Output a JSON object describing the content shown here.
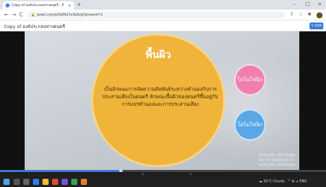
{
  "browser": {
    "tab_title": "Copy of องค์ประกอบทางดนตรี - P",
    "tab_close": "×",
    "new_tab": "+",
    "url": "prezi.com/p/5d0fa7e3e0zg?present=1",
    "nav_back": "←",
    "nav_forward": "→",
    "nav_reload": "C",
    "lock": "🔒"
  },
  "doc": {
    "title": "Copy of องค์ประกอบทางดนตรี",
    "edit_label": "✎ Edit"
  },
  "slide": {
    "main_title": "พื้นผิว",
    "main_body": "เป็นลักษณะการจัดความสัมพันธ์ระหว่างทำนองกับการประสานเสียงในดนตรี ลักษณะพื้นผิวของดนตรีขึ้นอยู่กับการแปรทำนองและการประสานเสียง",
    "circle_pink": "โมโนโฟนิก",
    "circle_blue": "โฮโมโฟนิก",
    "watermark_line1": "Activate Windows",
    "watermark_line2": "Go to Settings to activate Windows."
  },
  "player": {
    "progress_fraction": 0.37,
    "prev_label": "‹",
    "next_label": "›"
  },
  "taskbar": {
    "weather": "☁ 32°C Cloudy",
    "tray": "^ ⊕ ⊿ ENG"
  },
  "colors": {
    "accent": "#3a7bd5",
    "main_circle": "#f0b43a",
    "pink": "#f07fb0",
    "blue": "#59a7e6"
  }
}
